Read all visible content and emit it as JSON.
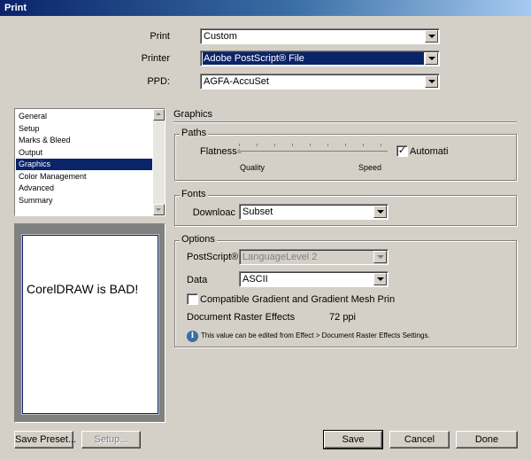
{
  "window": {
    "title": "Print"
  },
  "header": {
    "print_label": "Print",
    "print_value": "Custom",
    "printer_label": "Printer",
    "printer_value": "Adobe PostScript® File",
    "ppd_label": "PPD:",
    "ppd_value": "AGFA-AccuSet"
  },
  "sidebar": {
    "items": [
      {
        "label": "General"
      },
      {
        "label": "Setup"
      },
      {
        "label": "Marks & Bleed"
      },
      {
        "label": "Output"
      },
      {
        "label": "Graphics"
      },
      {
        "label": "Color Management"
      },
      {
        "label": "Advanced"
      },
      {
        "label": "Summary"
      }
    ],
    "selected": "Graphics"
  },
  "preview": {
    "text": "CorelDRAW is BAD!"
  },
  "section": {
    "title": "Graphics"
  },
  "paths": {
    "legend": "Paths",
    "flatness_label": "Flatness",
    "flatness_value": 0,
    "quality_label": "Quality",
    "speed_label": "Speed",
    "automatic_label": "Automati",
    "automatic_checked": true
  },
  "fonts": {
    "legend": "Fonts",
    "download_label": "Downloac",
    "download_value": "Subset"
  },
  "options": {
    "legend": "Options",
    "postscript_label": "PostScript®",
    "postscript_value": "LanguageLevel 2",
    "data_label": "Data",
    "data_value": "ASCII",
    "compat_label": "Compatible Gradient and Gradient Mesh Prin",
    "compat_checked": false,
    "raster_label": "Document Raster Effects",
    "raster_value": "72",
    "raster_unit": "ppi",
    "info_text": "This value can be edited from Effect > Document Raster Effects Settings."
  },
  "buttons": {
    "save_preset": "Save Preset...",
    "setup": "Setup...",
    "save": "Save",
    "cancel": "Cancel",
    "done": "Done"
  },
  "colors": {
    "selection": "#0a246a",
    "face": "#d4d0c8"
  },
  "icons": {
    "info": "info-icon",
    "dropdown": "chevron-down-icon",
    "check": "checkmark-icon"
  }
}
